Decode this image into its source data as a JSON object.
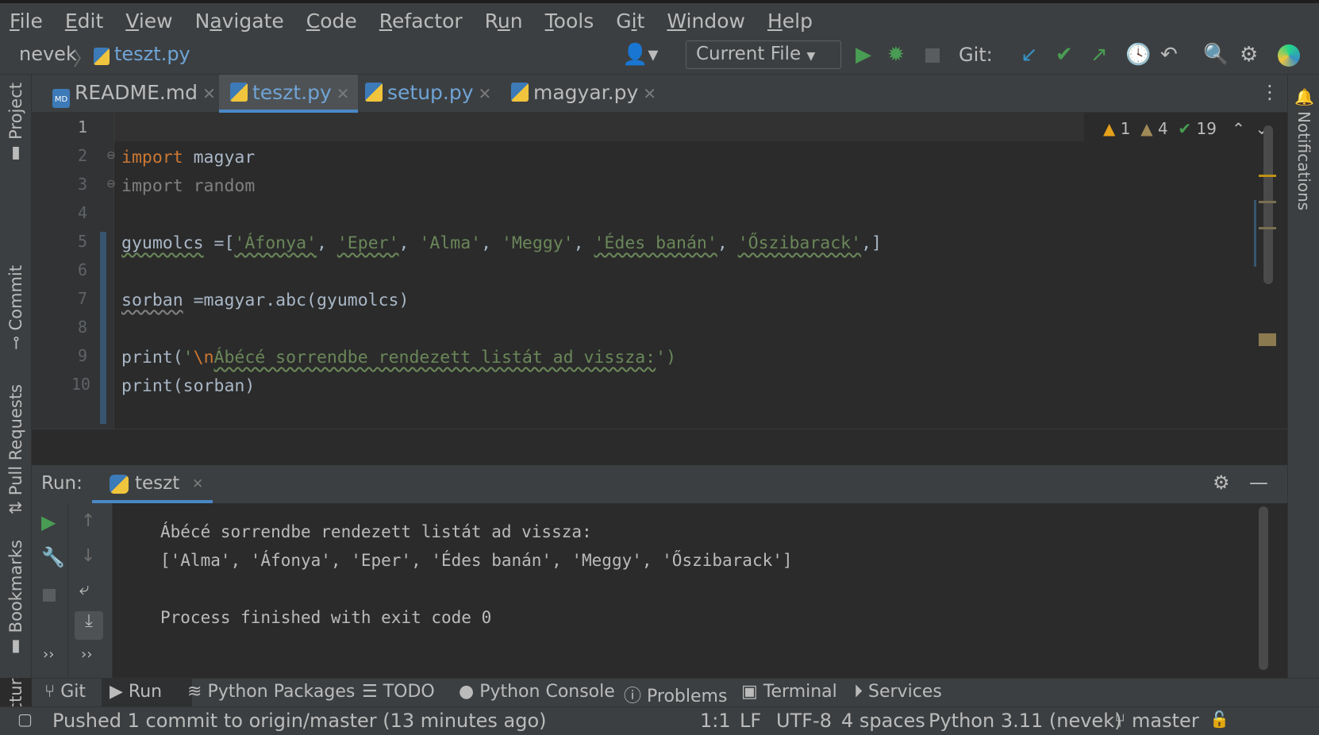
{
  "menu": [
    "File",
    "Edit",
    "View",
    "Navigate",
    "Code",
    "Refactor",
    "Run",
    "Tools",
    "Git",
    "Window",
    "Help"
  ],
  "menu_underline": [
    "F",
    "E",
    "V",
    "a",
    "C",
    "R",
    "u",
    "T",
    "i",
    "W",
    "H"
  ],
  "breadcrumb": {
    "project": "nevek",
    "file": "teszt.py"
  },
  "toolbar": {
    "run_config": "Current File",
    "git_label": "Git:"
  },
  "tabs": [
    {
      "label": "README.md",
      "active": false
    },
    {
      "label": "teszt.py",
      "active": true
    },
    {
      "label": "setup.py",
      "active": false
    },
    {
      "label": "magyar.py",
      "active": false
    }
  ],
  "side_left": [
    "Project",
    "Commit",
    "Pull Requests",
    "Bookmarks",
    "Structure"
  ],
  "side_right": [
    "Notifications"
  ],
  "inspections": {
    "warnings": "1",
    "weak_warnings": "4",
    "typos": "19"
  },
  "editor": {
    "line_numbers": [
      "1",
      "2",
      "3",
      "4",
      "5",
      "6",
      "7",
      "8",
      "9",
      "10"
    ],
    "line2_kw": "import",
    "line2_mod": " magyar",
    "line3": "import random",
    "line5_var": "gyumolcs",
    "line5_op": " =[",
    "line5_items": [
      "'Áfonya'",
      "'Eper'",
      "'Alma'",
      "'Meggy'",
      "'Édes banán'",
      "'Őszibarack'"
    ],
    "line5_end": "]",
    "line7_var": "sorban",
    "line7_rest": " =magyar.abc(gyumolcs)",
    "line9_fn": "print(",
    "line9_q": "'",
    "line9_esc": "\\n",
    "line9_text": "Ábécé sorrendbe rendezett listát ad vissza:",
    "line9_end": "')",
    "line10": "print(sorban)"
  },
  "run": {
    "label": "Run:",
    "tab": "teszt",
    "output": [
      "Ábécé sorrendbe rendezett listát ad vissza:",
      "['Alma', 'Áfonya', 'Eper', 'Édes banán', 'Meggy', 'Őszibarack']",
      "",
      "Process finished with exit code 0"
    ]
  },
  "tool_tabs": [
    "Git",
    "Run",
    "Python Packages",
    "TODO",
    "Python Console",
    "Problems",
    "Terminal",
    "Services"
  ],
  "status": {
    "message": "Pushed 1 commit to origin/master (13 minutes ago)",
    "position": "1:1",
    "line_sep": "LF",
    "encoding": "UTF-8",
    "indent": "4 spaces",
    "interpreter": "Python 3.11 (nevek)",
    "branch": "master"
  },
  "colors": {
    "accent": "#4a88c7",
    "keyword": "#cc7832",
    "string": "#6a8759",
    "run_green": "#499c54",
    "warning": "#e5a21b"
  }
}
